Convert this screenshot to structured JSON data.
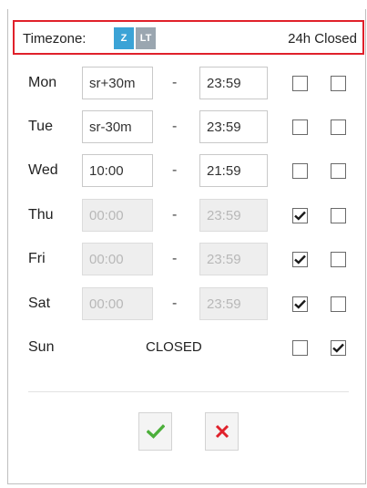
{
  "header": {
    "timezone_label": "Timezone:",
    "tz_zulu": "Z",
    "tz_local": "LT",
    "closed_24h_label": "24h Closed"
  },
  "days": [
    {
      "day": "Mon",
      "start": "sr+30m",
      "end": "23:59",
      "disabled": false,
      "check1": false,
      "check2": false
    },
    {
      "day": "Tue",
      "start": "sr-30m",
      "end": "23:59",
      "disabled": false,
      "check1": false,
      "check2": false
    },
    {
      "day": "Wed",
      "start": "10:00",
      "end": "21:59",
      "disabled": false,
      "check1": false,
      "check2": false
    },
    {
      "day": "Thu",
      "start": "00:00",
      "end": "23:59",
      "disabled": true,
      "check1": true,
      "check2": false
    },
    {
      "day": "Fri",
      "start": "00:00",
      "end": "23:59",
      "disabled": true,
      "check1": true,
      "check2": false
    },
    {
      "day": "Sat",
      "start": "00:00",
      "end": "23:59",
      "disabled": true,
      "check1": true,
      "check2": false
    },
    {
      "day": "Sun",
      "closed_text": "CLOSED",
      "check1": false,
      "check2": true
    }
  ],
  "separator": "-",
  "icons": {
    "ok": "checkmark-icon",
    "cancel": "close-icon"
  },
  "colors": {
    "accent": "#3ba3d6",
    "highlight_border": "#e0212b",
    "ok": "#4caf3b",
    "cancel": "#e0212b"
  }
}
